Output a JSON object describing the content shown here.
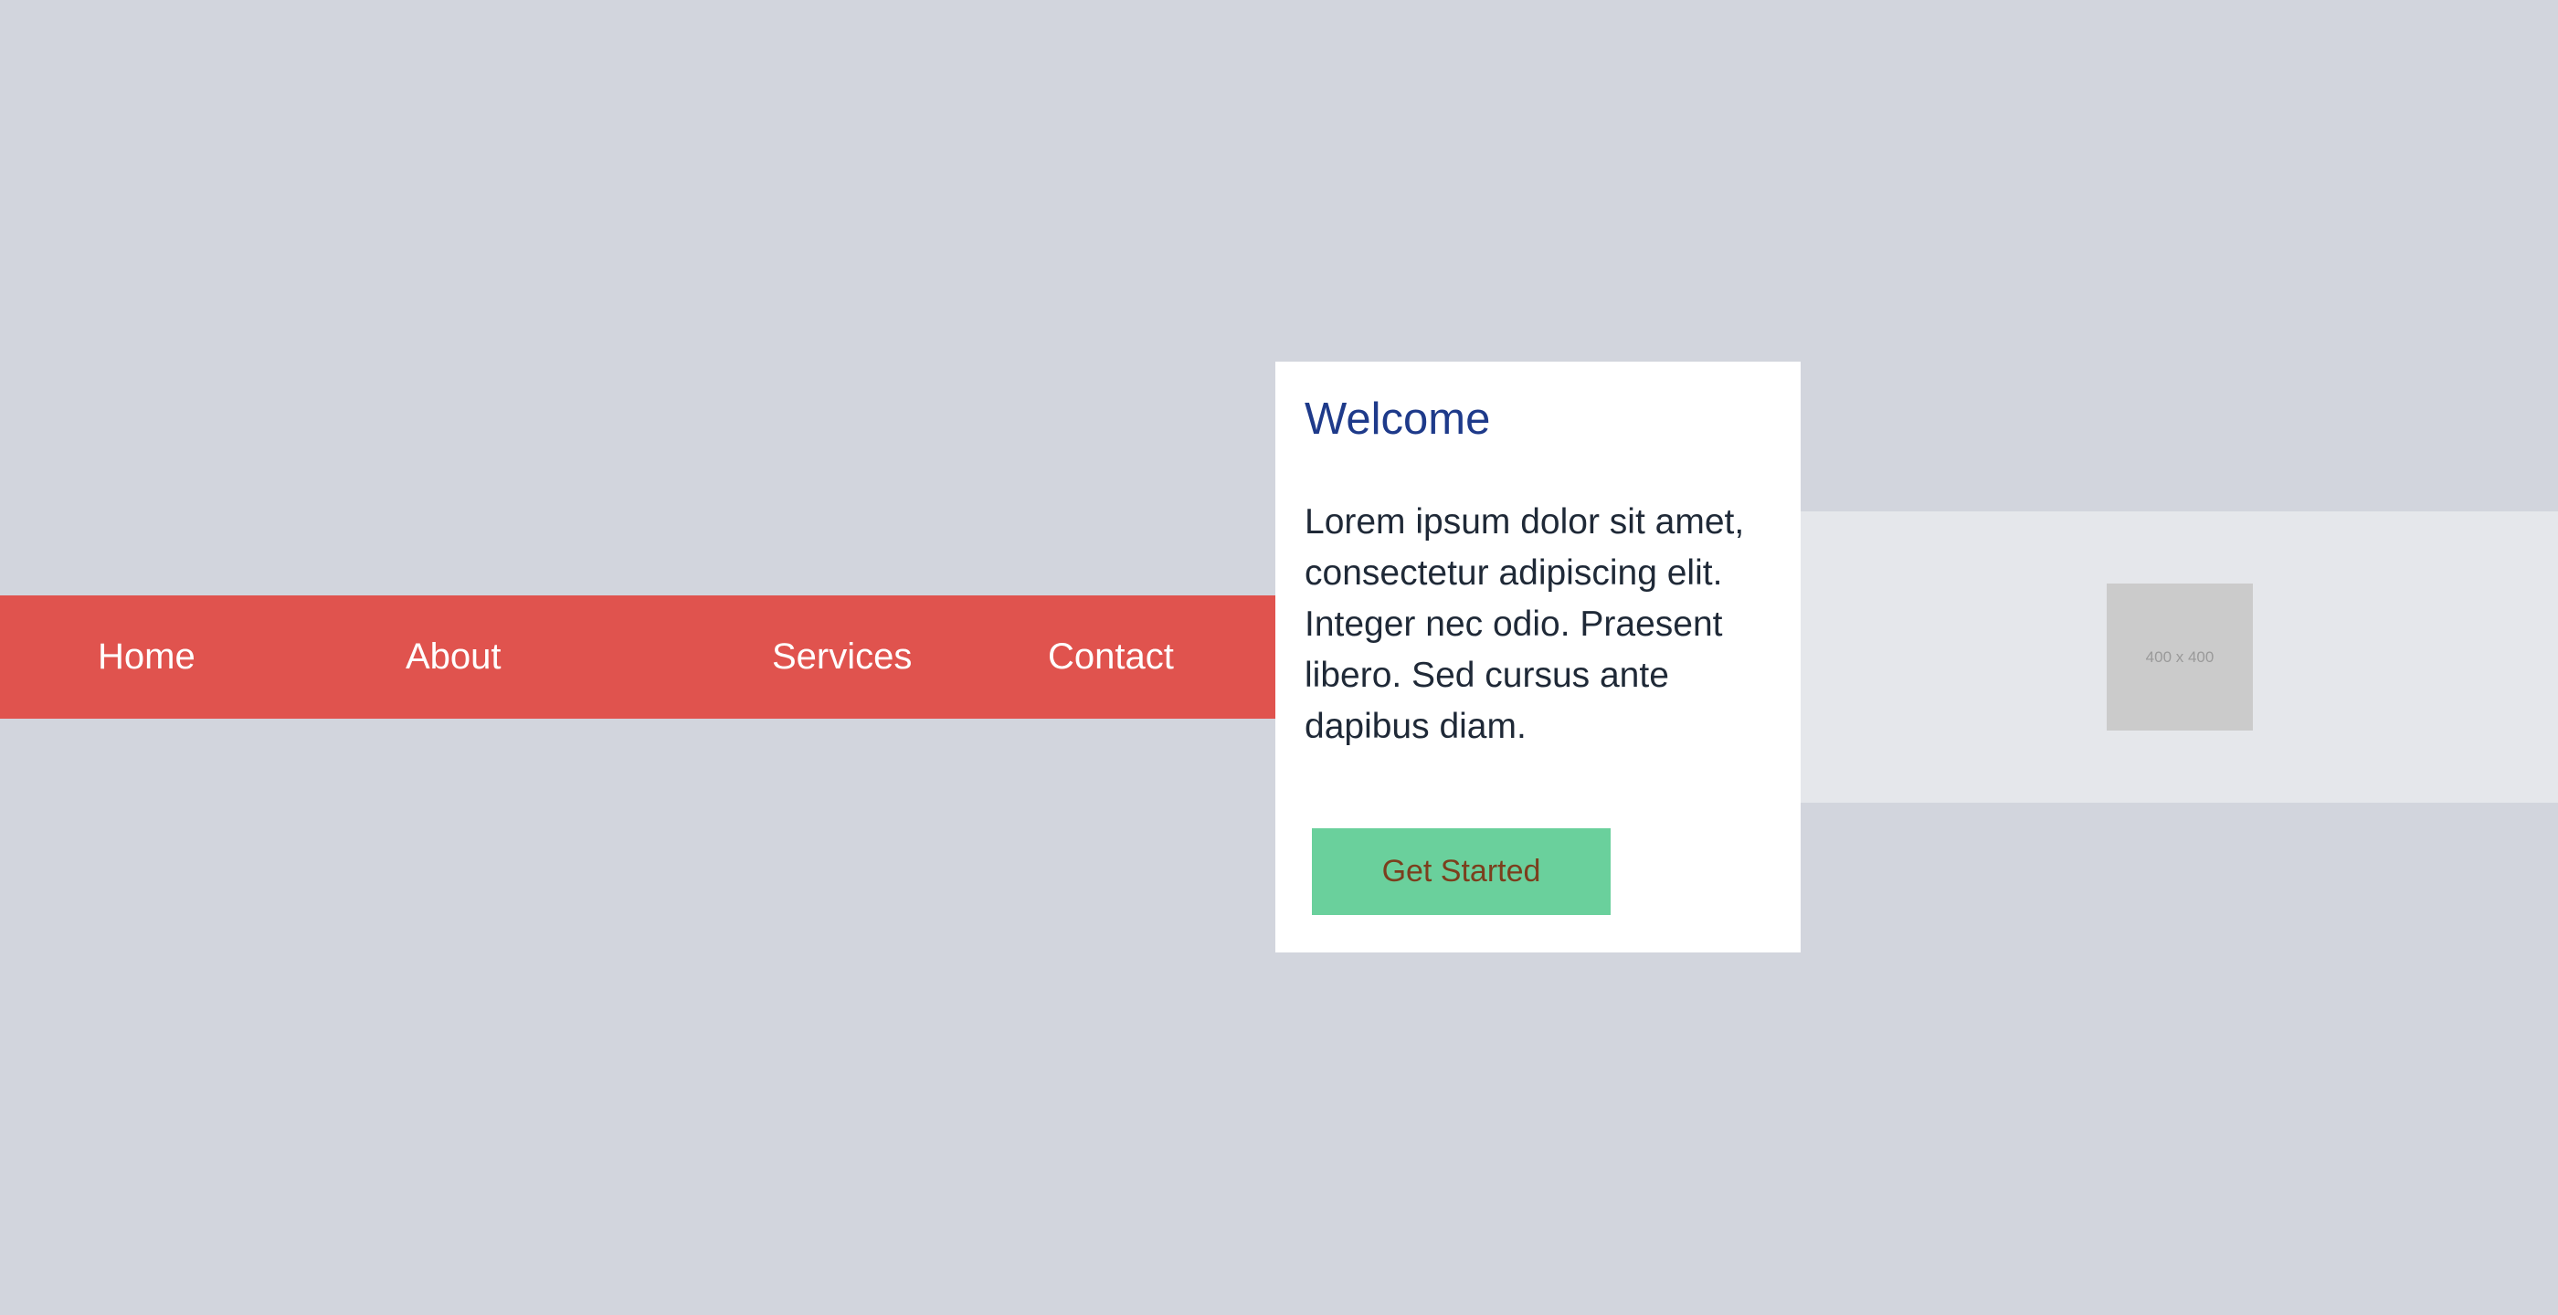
{
  "nav": {
    "items": [
      {
        "label": "Home"
      },
      {
        "label": "About"
      },
      {
        "label": "Services"
      },
      {
        "label": "Contact"
      }
    ]
  },
  "card": {
    "title": "Welcome",
    "body": "Lorem ipsum dolor sit amet, consectetur adipiscing elit. Integer nec odio. Praesent libero. Sed cursus ante dapibus diam.",
    "button_label": "Get Started"
  },
  "image": {
    "placeholder_text": "400 x 400"
  },
  "colors": {
    "background": "#d2d5dd",
    "nav_background": "#e0534e",
    "nav_text": "#ffffff",
    "card_background": "#ffffff",
    "title_color": "#1e3a8a",
    "body_text": "#1f2937",
    "button_background": "#6ad09c",
    "button_text": "#7b3f1d",
    "image_band_background": "#e5e7eb",
    "placeholder_background": "#cbcbcb"
  }
}
